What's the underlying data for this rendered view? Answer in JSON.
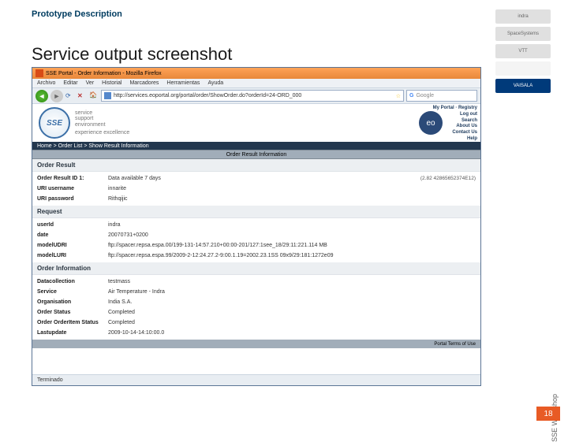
{
  "header": {
    "proto": "Prototype Description",
    "title": "Service output screenshot"
  },
  "sidebar_logos": [
    "indra",
    "SpaceSystems",
    "VTT",
    "",
    "VAISALA"
  ],
  "vertical": "SSE Workshop",
  "page_num": "18",
  "browser": {
    "title": "SSE Portal - Order Information - Mozilla Firefox",
    "menu": [
      "Archivo",
      "Editar",
      "Ver",
      "Historial",
      "Marcadores",
      "Herramientas",
      "Ayuda"
    ],
    "url": "http://services.eoportal.org/portal/order/ShowOrder.do?orderId=24-ORD_000",
    "search_placeholder": "Google",
    "status": "Terminado"
  },
  "page": {
    "sse_tag1": "service",
    "sse_tag2": "support",
    "sse_tag3": "environment",
    "sse_tag4": "experience excellence",
    "header_links": [
      "My Portal · Registry",
      "Log out",
      "Search",
      "About Us",
      "Contact Us",
      "Help"
    ],
    "breadcrumb": "Home > Order List > Show Result Information",
    "section_bar": "Order Result Information",
    "order_result": {
      "title": "Order Result",
      "rows": [
        {
          "label": "Order Result ID 1:",
          "value": "Data available 7 days",
          "extra": "(2.82 42865652374E12)"
        },
        {
          "label": "URI username",
          "value": "innarite",
          "extra": ""
        },
        {
          "label": "URI password",
          "value": "Rithqijic",
          "extra": ""
        }
      ]
    },
    "request": {
      "title": "Request",
      "rows": [
        {
          "label": "userId",
          "value": "indra"
        },
        {
          "label": "date",
          "value": "20070731+0200"
        },
        {
          "label": "modelUDRI",
          "value": "ftp://spacer.repsa.espa.00/199-131-14:57.210+00:00-201/127:1see_18/29:11:221.114 MB"
        },
        {
          "label": "modelLURI",
          "value": "ftp://spacer.repsa.espa.99/2009-2-12:24.27.2-9:00.1.19=2002.23.1SS 09x9/29:181:1272e09"
        }
      ]
    },
    "order_info": {
      "title": "Order Information",
      "rows": [
        {
          "label": "Datacollection",
          "value": "testmass"
        },
        {
          "label": "Service",
          "value": "Air Temperature - Indra"
        },
        {
          "label": "Organisation",
          "value": "India S.A."
        },
        {
          "label": "Order Status",
          "value": "Completed"
        },
        {
          "label": "Order OrderItem Status",
          "value": "Completed"
        },
        {
          "label": "Lastupdate",
          "value": "2009-10-14-14:10:00.0"
        }
      ]
    },
    "footer_links": [
      "Portal Terms of Use"
    ]
  }
}
